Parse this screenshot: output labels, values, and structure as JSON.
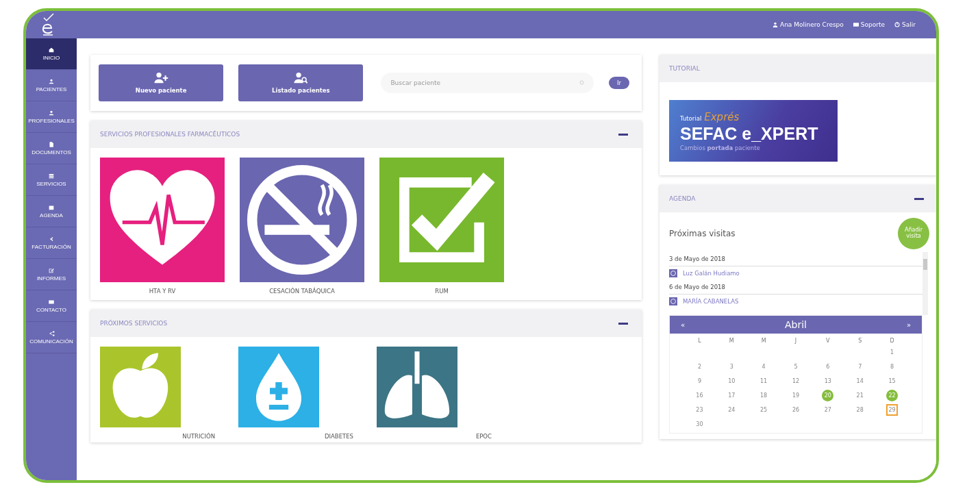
{
  "topbar": {
    "user": "Ana Molinero Crespo",
    "links": [
      {
        "kind": "support",
        "label": "Soporte"
      },
      {
        "kind": "logout",
        "label": "Salir"
      }
    ]
  },
  "sidebar": {
    "items": [
      {
        "label": "INICIO",
        "selected": true
      },
      {
        "label": "PACIENTES",
        "selected": false
      },
      {
        "label": "PROFESIONALES",
        "selected": false
      },
      {
        "label": "DOCUMENTOS",
        "selected": false
      },
      {
        "label": "SERVICIOS",
        "selected": false
      },
      {
        "label": "AGENDA",
        "selected": false
      },
      {
        "label": "FACTURACIÓN",
        "selected": false
      },
      {
        "label": "INFORMES",
        "selected": false
      },
      {
        "label": "CONTACTO",
        "selected": false
      },
      {
        "label": "COMUNICACIÓN",
        "selected": false
      }
    ]
  },
  "actions": {
    "buttons": [
      {
        "kind": "add",
        "label": "Nuevo paciente"
      },
      {
        "kind": "list",
        "label": "Listado pacientes"
      }
    ],
    "search": {
      "placeholder": "Buscar paciente"
    },
    "go": "Ir"
  },
  "sections": [
    {
      "title": "SERVICIOS PROFESIONALES FARMACÉUTICOS",
      "tiles": [
        {
          "kind": "heart",
          "label": "HTA Y RV",
          "color": "#e6207f"
        },
        {
          "kind": "nosmoking",
          "label": "CESACIÓN TABÁQUICA",
          "color": "#6a66b0"
        },
        {
          "kind": "check",
          "label": "RUM",
          "color": "#78b82e"
        }
      ]
    },
    {
      "title": "PRÓXIMOS SERVICIOS",
      "tiles": [
        {
          "kind": "apple",
          "label": "NUTRICIÓN",
          "color": "#a9c52b"
        },
        {
          "kind": "drop",
          "label": "DIABETES",
          "color": "#2cb0e6"
        },
        {
          "kind": "lungs",
          "label": "EPOC",
          "color": "#3c7585"
        }
      ]
    }
  ],
  "tutorial": {
    "title": "TUTORIAL",
    "banner": {
      "small": "Tutorial",
      "accent": "Exprés",
      "title": "SEFAC e_XPERT",
      "subtitle": "Cambios **portada** paciente"
    }
  },
  "agenda": {
    "title": "AGENDA",
    "heading": "Próximas visitas",
    "add_button": "Añadir visita",
    "visits": [
      {
        "date": "3 de Mayo de 2018",
        "patient": "Luz Galán Hudiamo"
      },
      {
        "date": "6 de Mayo de 2018",
        "patient": "MARÍA CABANELAS"
      }
    ],
    "calendar": {
      "month": "Abril",
      "prev": "«",
      "next": "»",
      "weekdays": [
        "L",
        "M",
        "M",
        "J",
        "V",
        "S",
        "D"
      ],
      "weeks": [
        [
          {
            "d": "1",
            "event": false,
            "today": false
          }
        ],
        [
          {
            "d": "2",
            "event": false,
            "today": false
          },
          {
            "d": "3",
            "event": false,
            "today": false
          },
          {
            "d": "4",
            "event": false,
            "today": false
          },
          {
            "d": "5",
            "event": false,
            "today": false
          },
          {
            "d": "6",
            "event": false,
            "today": false
          },
          {
            "d": "7",
            "event": false,
            "today": false
          },
          {
            "d": "8",
            "event": false,
            "today": false
          }
        ],
        [
          {
            "d": "9",
            "event": false,
            "today": false
          },
          {
            "d": "10",
            "event": false,
            "today": false
          },
          {
            "d": "11",
            "event": false,
            "today": false
          },
          {
            "d": "12",
            "event": false,
            "today": false
          },
          {
            "d": "13",
            "event": false,
            "today": false
          },
          {
            "d": "14",
            "event": false,
            "today": false
          },
          {
            "d": "15",
            "event": false,
            "today": false
          }
        ],
        [
          {
            "d": "16",
            "event": false,
            "today": false
          },
          {
            "d": "17",
            "event": false,
            "today": false
          },
          {
            "d": "18",
            "event": false,
            "today": false
          },
          {
            "d": "19",
            "event": false,
            "today": false
          },
          {
            "d": "20",
            "event": true,
            "today": false
          },
          {
            "d": "21",
            "event": false,
            "today": false
          },
          {
            "d": "22",
            "event": true,
            "today": false
          }
        ],
        [
          {
            "d": "23",
            "event": false,
            "today": false
          },
          {
            "d": "24",
            "event": false,
            "today": false
          },
          {
            "d": "25",
            "event": false,
            "today": false
          },
          {
            "d": "26",
            "event": false,
            "today": false
          },
          {
            "d": "27",
            "event": false,
            "today": false
          },
          {
            "d": "28",
            "event": false,
            "today": false
          },
          {
            "d": "29",
            "event": false,
            "today": true
          }
        ],
        [
          {
            "d": "30",
            "event": false,
            "today": false
          }
        ]
      ]
    }
  }
}
